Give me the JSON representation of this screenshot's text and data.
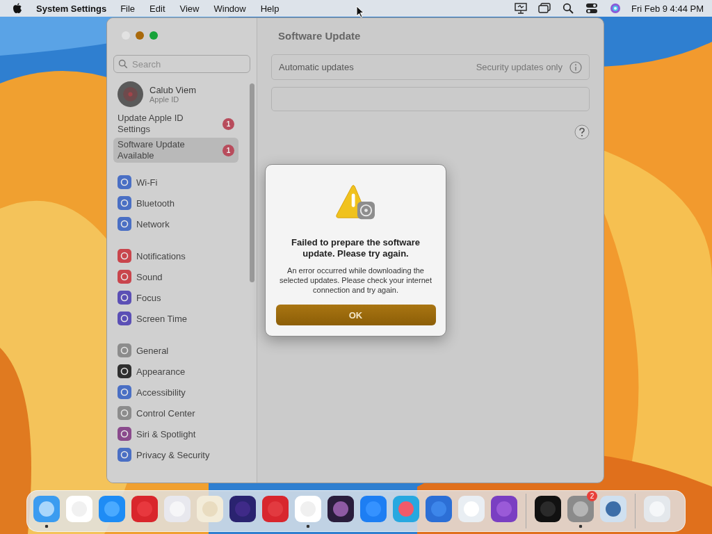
{
  "menu_bar": {
    "app_name": "System Settings",
    "menus": [
      "File",
      "Edit",
      "View",
      "Window",
      "Help"
    ],
    "clock": "Fri Feb 9  4:44 PM"
  },
  "window": {
    "search": {
      "placeholder": "Search"
    },
    "account": {
      "name": "Calub Viem",
      "subtitle": "Apple ID"
    },
    "alerts": [
      {
        "label": "Update Apple ID Settings",
        "badge": "1",
        "selected": false
      },
      {
        "label": "Software Update Available",
        "badge": "1",
        "selected": true
      }
    ],
    "sidebar_groups": [
      [
        {
          "label": "Wi-Fi",
          "color": "#4a6fc4"
        },
        {
          "label": "Bluetooth",
          "color": "#4a6fc4"
        },
        {
          "label": "Network",
          "color": "#4a6fc4"
        }
      ],
      [
        {
          "label": "Notifications",
          "color": "#c9454c"
        },
        {
          "label": "Sound",
          "color": "#c9454c"
        },
        {
          "label": "Focus",
          "color": "#5b4fb5"
        },
        {
          "label": "Screen Time",
          "color": "#5b4fb5"
        }
      ],
      [
        {
          "label": "General",
          "color": "#8c8c8c"
        },
        {
          "label": "Appearance",
          "color": "#2f2f2f"
        },
        {
          "label": "Accessibility",
          "color": "#4a6fc4"
        },
        {
          "label": "Control Center",
          "color": "#8c8c8c"
        },
        {
          "label": "Siri & Spotlight",
          "color": "#8a4a8c"
        },
        {
          "label": "Privacy & Security",
          "color": "#4a6fc4"
        }
      ]
    ],
    "content": {
      "title": "Software Update",
      "setting_label": "Automatic updates",
      "setting_value": "Security updates only"
    }
  },
  "dialog": {
    "title": "Failed to prepare the software update. Please try again.",
    "message": "An error occurred while downloading the selected updates. Please check your internet connection and try again.",
    "button": "OK"
  },
  "dock": [
    {
      "running": true
    },
    {
      "running": false
    },
    {
      "running": false
    },
    {
      "running": false
    },
    {
      "running": false
    },
    {
      "running": false
    },
    {
      "running": false
    },
    {
      "running": false
    },
    {
      "running": true
    },
    {
      "running": false
    },
    {
      "running": false
    },
    {
      "running": false
    },
    {
      "running": false
    },
    {
      "running": false
    },
    {
      "running": false
    },
    {
      "running": false,
      "separator_before": true
    },
    {
      "running": true,
      "badge": "2"
    },
    {
      "running": false
    },
    {
      "running": false,
      "separator_before": true
    }
  ]
}
